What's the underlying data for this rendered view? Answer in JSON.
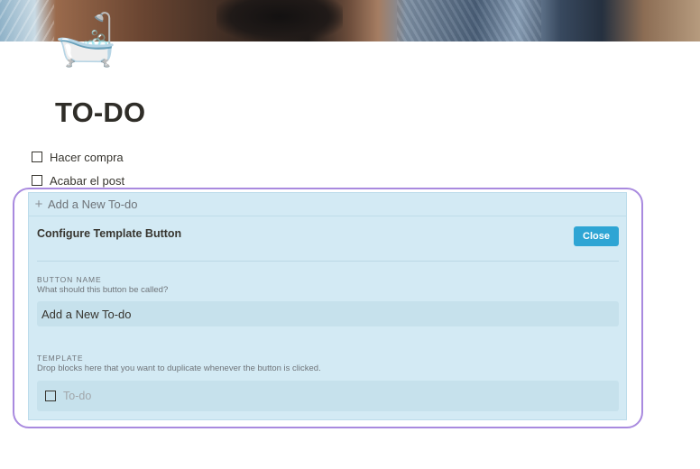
{
  "page": {
    "icon": "🛁",
    "icon_name": "bathtub-icon",
    "title": "TO-DO"
  },
  "todos": [
    {
      "label": "Hacer compra",
      "checked": false
    },
    {
      "label": "Acabar el post",
      "checked": false
    }
  ],
  "template_button": {
    "add_label": "Add a New To-do",
    "add_icon": "plus-icon",
    "config_title": "Configure Template Button",
    "close_label": "Close",
    "button_name": {
      "section_label": "BUTTON NAME",
      "help": "What should this button be called?",
      "value": "Add a New To-do"
    },
    "template": {
      "section_label": "TEMPLATE",
      "help": "Drop blocks here that you want to duplicate whenever the button is clicked.",
      "todo_placeholder": "To-do"
    }
  },
  "colors": {
    "panel_bg": "#d3eaf4",
    "close_button": "#2ea5d4",
    "highlight_ring": "#a98adf"
  }
}
